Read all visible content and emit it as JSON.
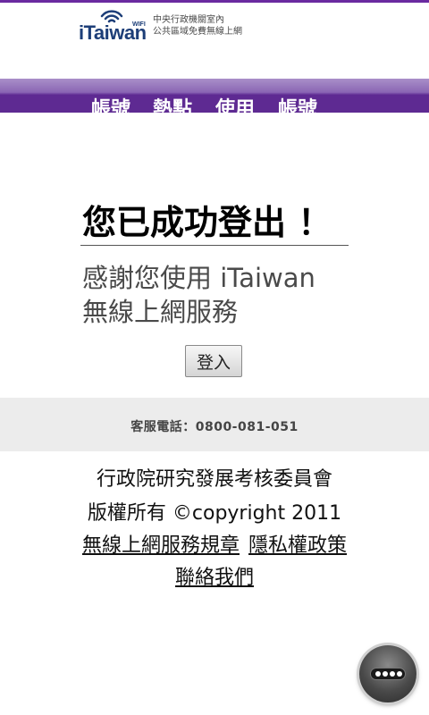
{
  "header": {
    "logo_text": "iTaiwan",
    "logo_badge": "WIFI",
    "caption_line1": "中央行政機關室內",
    "caption_line2": "公共區域免費無線上網"
  },
  "nav": {
    "items": [
      {
        "label": "帳號"
      },
      {
        "label": "熱點"
      },
      {
        "label": "使用"
      },
      {
        "label": "帳號"
      }
    ]
  },
  "main": {
    "title": "您已成功登出 ！",
    "thanks_line1": "感謝您使用  iTaiwan",
    "thanks_line2": "無線上網服務",
    "login_label": "登入"
  },
  "service": {
    "phone_text": "客服電話：0800-081-051"
  },
  "footer": {
    "org": "行政院研究發展考核委員會",
    "copyright": "版權所有  ©copyright 2011",
    "terms_link": "無線上網服務規章",
    "privacy_link": "隱私權政策",
    "contact_link": "聯絡我們"
  },
  "colors": {
    "brand_purple": "#5e2a92",
    "logo_blue": "#1d3e78",
    "logo_red": "#d8262f"
  }
}
